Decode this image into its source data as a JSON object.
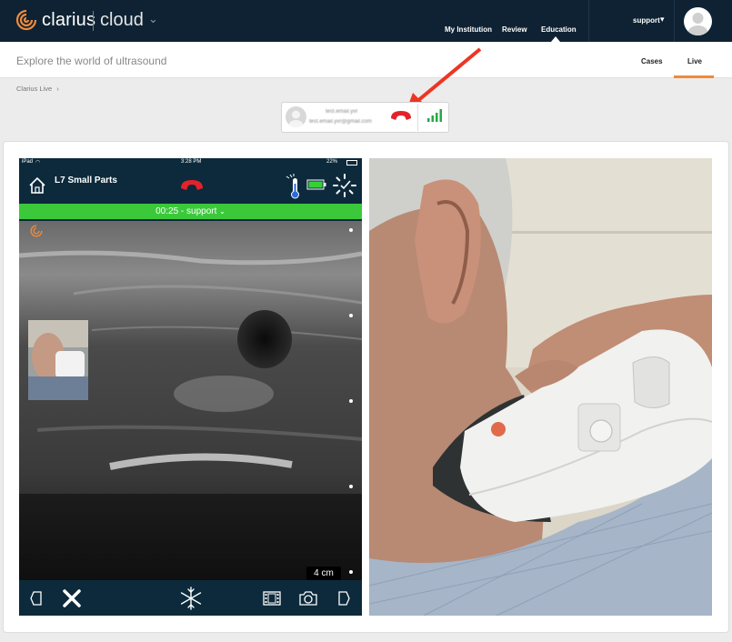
{
  "brand": {
    "name": "clarius",
    "product": "cloud",
    "accent": "#f08a3a"
  },
  "topnav": {
    "items": [
      "My Institution",
      "Review",
      "Education"
    ],
    "active": "Education",
    "user": "support"
  },
  "subheader": {
    "title": "Explore the world of ultrasound",
    "tabs": [
      "Cases",
      "Live"
    ],
    "active_tab": "Live"
  },
  "breadcrumb": {
    "label": "Clarius Live",
    "separator": "›"
  },
  "call": {
    "name": "test.email.yvr",
    "email": "test.email.yvr@gmail.com",
    "hangup_color": "#e3222a",
    "signal_color": "#27a845"
  },
  "ipad": {
    "status": {
      "device": "iPad",
      "time": "3:28 PM",
      "battery": "22%"
    },
    "probe": "L7 Small Parts",
    "session": {
      "timer": "00:25",
      "user": "support",
      "separator": " - "
    },
    "depth": "4 cm",
    "colors": {
      "header": "#0c2a3b",
      "session_bar": "#3bc93b"
    }
  }
}
